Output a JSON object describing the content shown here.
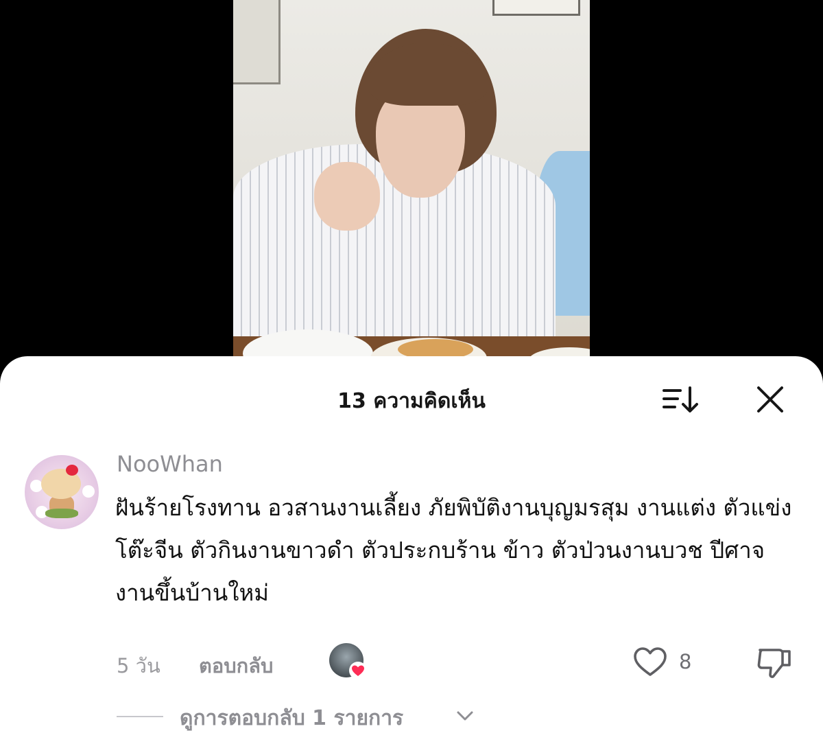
{
  "sheet": {
    "title": "13 ความคิดเห็น",
    "sort_icon": "sort-descending-icon",
    "close_icon": "close-icon"
  },
  "comment": {
    "username": "NooWhan",
    "text": "ฝันร้ายโรงทาน อวสานงานเลี้ยง ภัยพิบัติงานบุญมรสุม งานแต่ง ตัวแข่งโต๊ะจีน ตัวกินงานขาวดำ ตัวประกบร้าน ข้าว ตัวป่วนงานบวช ปีศาจงานขึ้นบ้านใหม่",
    "time": "5 วัน",
    "reply_label": "ตอบกลับ",
    "like_count": "8",
    "view_replies_label": "ดูการตอบกลับ 1 รายการ"
  },
  "colors": {
    "accent_heart": "#fe2c55",
    "muted_text": "#8e8e93",
    "sheet_bg": "#ffffff"
  }
}
